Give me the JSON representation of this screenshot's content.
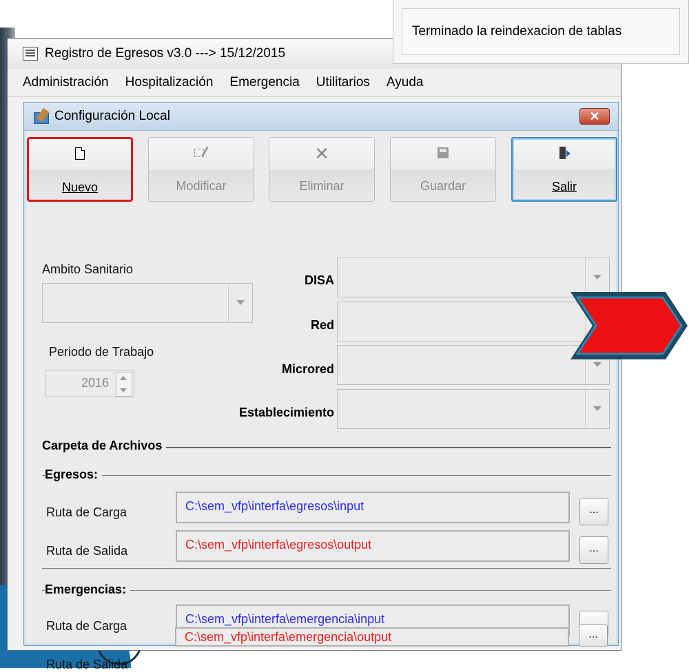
{
  "status_popup": {
    "message": "Terminado la reindexacion de tablas"
  },
  "app": {
    "title": "Registro de Egresos v3.0  ---> 15/12/2015",
    "menu": [
      {
        "label": "Administración"
      },
      {
        "label": "Hospitalización"
      },
      {
        "label": "Emergencia"
      },
      {
        "label": "Utilitarios"
      },
      {
        "label": "Ayuda"
      }
    ]
  },
  "dialog": {
    "title": "Configuración Local",
    "close_glyph": "✕",
    "toolbar": {
      "nuevo": {
        "label": "Nuevo",
        "icon": "new-document-icon"
      },
      "modificar": {
        "label": "Modificar",
        "icon": "edit-icon"
      },
      "eliminar": {
        "label": "Eliminar",
        "icon": "delete-icon"
      },
      "guardar": {
        "label": "Guardar",
        "icon": "save-icon"
      },
      "salir": {
        "label": "Salir",
        "icon": "exit-door-icon"
      }
    },
    "ambito": {
      "label": "Ambito Sanitario",
      "value": ""
    },
    "disa": {
      "label": "DISA",
      "value": ""
    },
    "red": {
      "label": "Red",
      "value": ""
    },
    "microred": {
      "label": "Microred",
      "value": ""
    },
    "establecimiento": {
      "label": "Establecimiento",
      "value": ""
    },
    "periodo": {
      "label": "Periodo de Trabajo",
      "value": "2016"
    },
    "carpeta": {
      "title": "Carpeta de Archivos"
    },
    "egresos": {
      "title": "Egresos:",
      "carga_label": "Ruta de Carga",
      "carga_value": "C:\\sem_vfp\\interfa\\egresos\\input",
      "salida_label": "Ruta de Salida",
      "salida_value": "C:\\sem_vfp\\interfa\\egresos\\output"
    },
    "emergencias": {
      "title": "Emergencias:",
      "carga_label": "Ruta de Carga",
      "carga_value": "C:\\sem_vfp\\interfa\\emergencia\\input",
      "salida_label": "Ruta de Salida",
      "salida_value": "C:\\sem_vfp\\interfa\\emergencia\\output"
    },
    "browse_label": "..."
  },
  "colors": {
    "input_path": "#2c2cf0",
    "output_path": "#ef1d1d",
    "highlight": "#e0161a"
  }
}
